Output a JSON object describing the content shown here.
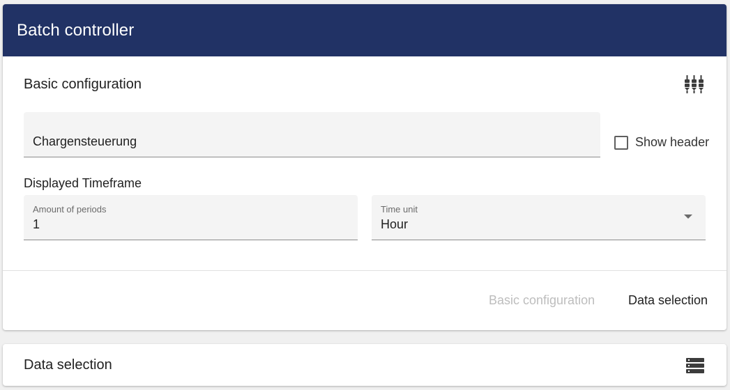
{
  "header": {
    "title": "Batch controller"
  },
  "basic_config": {
    "section_title": "Basic configuration",
    "settings_icon": "tune-icon",
    "name_field": {
      "value": "Chargensteuerung"
    },
    "show_header": {
      "label": "Show header",
      "checked": false
    },
    "timeframe_label": "Displayed Timeframe",
    "amount_field": {
      "label": "Amount of periods",
      "value": "1"
    },
    "time_unit_field": {
      "label": "Time unit",
      "value": "Hour"
    }
  },
  "footer_nav": {
    "basic_config_label": "Basic configuration",
    "data_selection_label": "Data selection"
  },
  "data_selection": {
    "section_title": "Data selection",
    "icon": "list-icon"
  },
  "colors": {
    "header_bg": "#213265",
    "field_bg": "#f4f4f4",
    "disabled_text": "#bdbdbd"
  }
}
